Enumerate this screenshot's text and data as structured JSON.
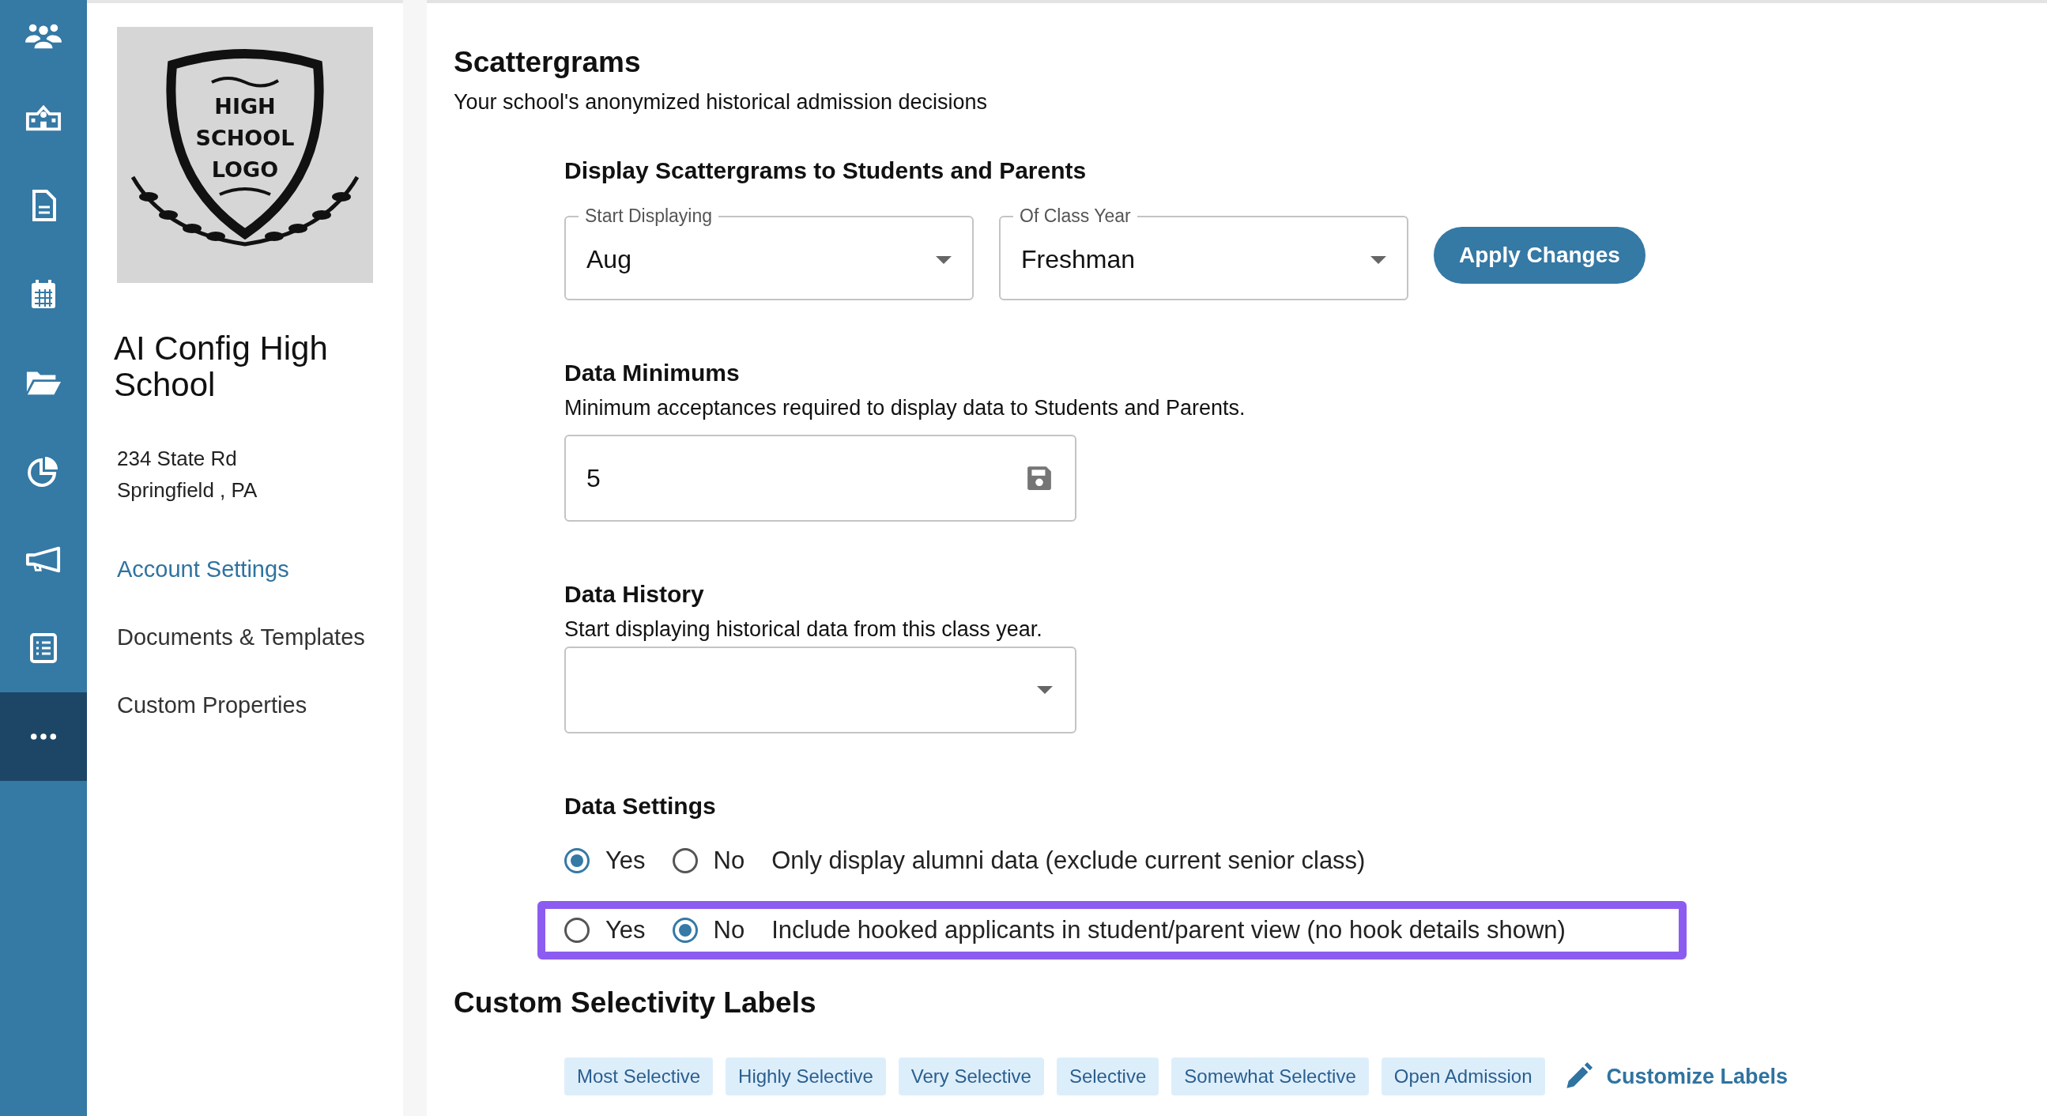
{
  "nav_rail": {
    "items": [
      {
        "kind": "people",
        "selected": false
      },
      {
        "kind": "school",
        "selected": false
      },
      {
        "kind": "document",
        "selected": false
      },
      {
        "kind": "calendar",
        "selected": false
      },
      {
        "kind": "folder",
        "selected": false
      },
      {
        "kind": "pie",
        "selected": false
      },
      {
        "kind": "megaphone",
        "selected": false
      },
      {
        "kind": "checklist",
        "selected": false
      },
      {
        "kind": "more",
        "selected": true
      }
    ]
  },
  "school_panel": {
    "logo_text": [
      "HIGH",
      "SCHOOL",
      "LOGO"
    ],
    "name": "AI Config High School",
    "address": [
      "234 State Rd",
      "Springfield , PA"
    ],
    "links": [
      {
        "label": "Account Settings",
        "selected": true
      },
      {
        "label": "Documents & Templates",
        "selected": false
      },
      {
        "label": "Custom Properties",
        "selected": false
      }
    ]
  },
  "scattergrams": {
    "title": "Scattergrams",
    "subtitle": "Your school's anonymized historical admission decisions",
    "display": {
      "heading": "Display Scattergrams to Students and Parents",
      "selects": [
        {
          "label": "Start Displaying",
          "value": "Aug"
        },
        {
          "label": "Of Class Year",
          "value": "Freshman"
        }
      ],
      "apply_button": "Apply Changes"
    },
    "minimums": {
      "heading": "Data Minimums",
      "description": "Minimum acceptances required to display data to Students and Parents.",
      "value": "5"
    },
    "history": {
      "heading": "Data History",
      "description": "Start displaying historical data from this class year."
    },
    "settings": {
      "heading": "Data Settings",
      "rows": [
        {
          "options": [
            {
              "label": "Yes",
              "selected": true
            },
            {
              "label": "No",
              "selected": false
            }
          ],
          "text": "Only display alumni data (exclude current senior class)",
          "highlighted": false
        },
        {
          "options": [
            {
              "label": "Yes",
              "selected": false
            },
            {
              "label": "No",
              "selected": true
            }
          ],
          "text": "Include hooked applicants in student/parent view (no hook details shown)",
          "highlighted": true
        }
      ]
    }
  },
  "selectivity": {
    "title": "Custom Selectivity Labels",
    "labels": [
      "Most Selective",
      "Highly Selective",
      "Very Selective",
      "Selective",
      "Somewhat Selective",
      "Open Admission"
    ],
    "customize_link": "Customize Labels"
  }
}
